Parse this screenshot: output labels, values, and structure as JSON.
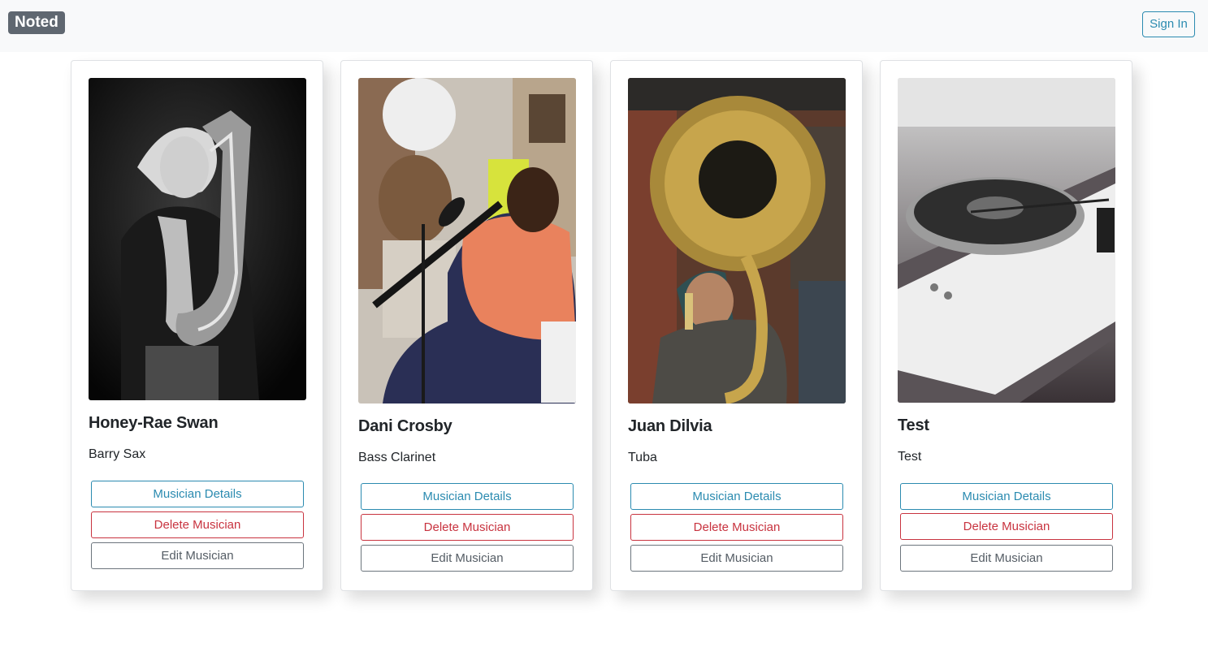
{
  "app": {
    "brand": "Noted",
    "sign_in_label": "Sign In"
  },
  "musicians": [
    {
      "name": "Honey-Rae Swan",
      "instrument": "Barry Sax",
      "photo_icon": "saxophone-player-photo",
      "details_label": "Musician Details",
      "delete_label": "Delete Musician",
      "edit_label": "Edit Musician"
    },
    {
      "name": "Dani Crosby",
      "instrument": "Bass Clarinet",
      "photo_icon": "clarinet-player-photo",
      "details_label": "Musician Details",
      "delete_label": "Delete Musician",
      "edit_label": "Edit Musician"
    },
    {
      "name": "Juan Dilvia",
      "instrument": "Tuba",
      "photo_icon": "sousaphone-player-photo",
      "details_label": "Musician Details",
      "delete_label": "Delete Musician",
      "edit_label": "Edit Musician"
    },
    {
      "name": "Test",
      "instrument": "Test",
      "photo_icon": "turntable-photo",
      "details_label": "Musician Details",
      "delete_label": "Delete Musician",
      "edit_label": "Edit Musician"
    }
  ],
  "colors": {
    "navbar_bg": "#f8f9fa",
    "brand_badge": "#5f6770",
    "info": "#2b8bb0",
    "danger": "#c8333f",
    "secondary": "#6c757d"
  }
}
